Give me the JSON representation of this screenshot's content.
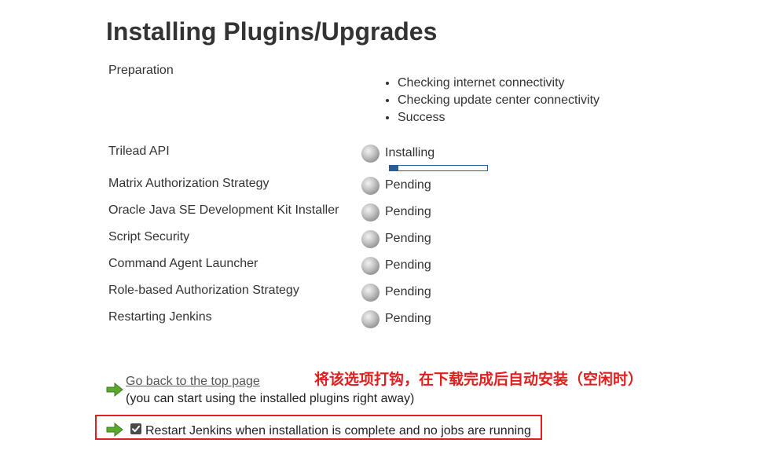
{
  "page": {
    "title": "Installing Plugins/Upgrades"
  },
  "preparation": {
    "label": "Preparation",
    "steps": [
      "Checking internet connectivity",
      "Checking update center connectivity",
      "Success"
    ]
  },
  "plugins": [
    {
      "name": "Trilead API",
      "status": "Installing",
      "progress_fraction": 0.09
    },
    {
      "name": "Matrix Authorization Strategy",
      "status": "Pending"
    },
    {
      "name": "Oracle Java SE Development Kit Installer",
      "status": "Pending"
    },
    {
      "name": "Script Security",
      "status": "Pending"
    },
    {
      "name": "Command Agent Launcher",
      "status": "Pending"
    },
    {
      "name": "Role-based Authorization Strategy",
      "status": "Pending"
    },
    {
      "name": "Restarting Jenkins",
      "status": "Pending"
    }
  ],
  "footer": {
    "back_link": "Go back to the top page",
    "back_note": "(you can start using the installed plugins right away)",
    "restart_label": "Restart Jenkins when installation is complete and no jobs are running",
    "restart_checked": true
  },
  "annotation": {
    "text": "将该选项打钩，在下载完成后自动安装（空闲时）",
    "color": "#e0201f"
  },
  "colors": {
    "progress": "#2b5a9e",
    "arrow": "#5aa832"
  },
  "icons": {
    "status": "status-ball-icon",
    "arrow": "green-arrow-icon",
    "check": "checkmark-icon"
  }
}
